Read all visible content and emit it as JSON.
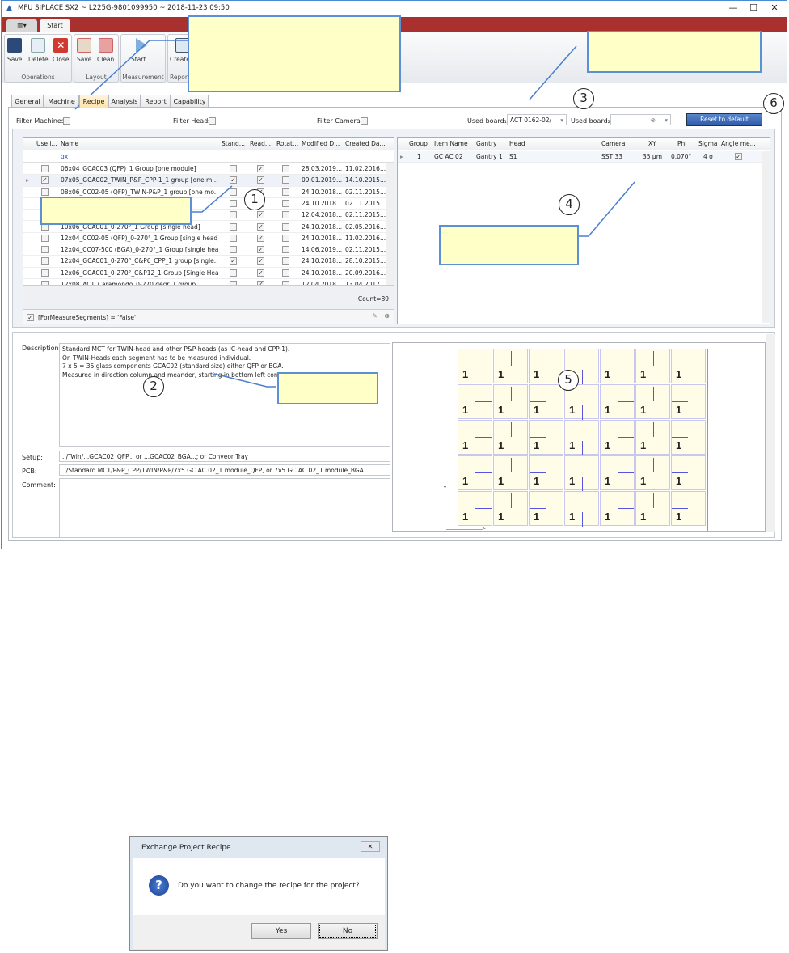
{
  "window": {
    "title": "MFU SIPLACE SX2 ~ L225G-9801099950 ~ 2018-11-23 09:50",
    "minimize": "—",
    "maximize": "☐",
    "close": "✕"
  },
  "ribbon": {
    "tabs": [
      "▥▾",
      "Start"
    ],
    "groups": [
      {
        "label": "Operations",
        "buttons": [
          "Save",
          "Delete",
          "Close"
        ]
      },
      {
        "label": "Layout",
        "buttons": [
          "Save",
          "Clean"
        ]
      },
      {
        "label": "Measurement",
        "buttons": [
          "Start..."
        ]
      },
      {
        "label": "Report",
        "buttons": [
          "Create..."
        ]
      }
    ]
  },
  "tabs": [
    "General",
    "Machine",
    "Recipe",
    "Analysis",
    "Report",
    "Capability"
  ],
  "active_tab": "Recipe",
  "filters": {
    "machines": "Filter Machines",
    "heads": "Filter Heads",
    "cameras": "Filter Cameras"
  },
  "boards": {
    "label1": "Used board₁:",
    "value1": "ACT 0162-02/",
    "label2": "Used board₂:",
    "value2": "",
    "reset": "Reset to default"
  },
  "recipe_grid": {
    "columns": [
      "Use i...",
      "Name",
      "Stand...",
      "Read...",
      "Rotat...",
      "Modified D...",
      "Created Da..."
    ],
    "filter_text": "ɑx",
    "rows": [
      {
        "use": false,
        "name": "06x04_GCAC03 (QFP)_1 Group [one module]",
        "std": false,
        "read": true,
        "rot": false,
        "mod": "28.03.2019...",
        "cre": "11.02.2016..."
      },
      {
        "use": true,
        "name": "07x05_GCAC02_TWIN_P&P_CPP-1_1 group [one m...",
        "std": true,
        "read": true,
        "rot": false,
        "mod": "09.01.2019...",
        "cre": "14.10.2015..."
      },
      {
        "use": false,
        "name": "08x06_CC02-05 (QFP)_TWIN-P&P_1 group [one mo...",
        "std": false,
        "read": true,
        "rot": false,
        "mod": "24.10.2018...",
        "cre": "02.11.2015..."
      },
      {
        "use": false,
        "name": "1 gro...",
        "std": false,
        "read": true,
        "rot": false,
        "mod": "24.10.2018...",
        "cre": "02.11.2015..."
      },
      {
        "use": false,
        "name": "e mo...",
        "std": false,
        "read": true,
        "rot": false,
        "mod": "12.04.2018...",
        "cre": "02.11.2015..."
      },
      {
        "use": false,
        "name": "10x06_GCAC01_0-270°_1 Group [single head]",
        "std": false,
        "read": true,
        "rot": false,
        "mod": "24.10.2018...",
        "cre": "02.05.2016..."
      },
      {
        "use": false,
        "name": "12x04_CC02-05 (QFP)_0-270°_1 Group [single head]",
        "std": false,
        "read": true,
        "rot": false,
        "mod": "24.10.2018...",
        "cre": "11.02.2016..."
      },
      {
        "use": false,
        "name": "12x04_CC07-500 (BGA)_0-270°_1 Group [single head]",
        "std": false,
        "read": true,
        "rot": false,
        "mod": "14.06.2019...",
        "cre": "02.11.2015..."
      },
      {
        "use": false,
        "name": "12x04_GCAC01_0-270°_C&P6_CPP_1 group [single...",
        "std": true,
        "read": true,
        "rot": false,
        "mod": "24.10.2018...",
        "cre": "28.10.2015..."
      },
      {
        "use": false,
        "name": "12x06_GCAC01_0-270°_C&P12_1 Group [Single Hea...",
        "std": false,
        "read": true,
        "rot": false,
        "mod": "24.10.2018...",
        "cre": "20.09.2016..."
      },
      {
        "use": false,
        "name": "12x08_ACT_Caramondo_0-270 degr_1 group",
        "std": false,
        "read": true,
        "rot": false,
        "mod": "12.04.2018...",
        "cre": "13.04.2017..."
      }
    ],
    "count": "Count=89",
    "filter_expr": "[ForMeasureSegments] = 'False'"
  },
  "item_grid": {
    "columns": [
      "Group",
      "Item Name",
      "Gantry",
      "Head",
      "Camera",
      "XY",
      "Phi",
      "Sigma",
      "Angle me..."
    ],
    "rows": [
      {
        "group": "1",
        "item": "GC AC 02",
        "gantry": "Gantry 1",
        "head": "S1",
        "camera": "SST 33",
        "xy": "35 µm",
        "phi": "0.070°",
        "sigma": "4 σ",
        "angle": true
      }
    ]
  },
  "details": {
    "description_label": "Description:",
    "description": [
      "Standard MCT for TWIN-head and other P&P-heads (as IC-head and CPP-1).",
      "On TWIN-Heads each segment has to be measured individual.",
      "7 x 5 = 35 glass components GCAC02 (standard size) either QFP or BGA.",
      "Measured in direction column and meander, starting in bottom left corner."
    ],
    "setup_label": "Setup:",
    "setup": "../Twin/...GCAC02_QFP... or ...GCAC02_BGA...; or Conveor Tray",
    "pcb_label": "PCB:",
    "pcb": "../Standard MCT/P&P_CPP/TWIN/P&P/7x5 GC AC 02_1 module_QFP, or 7x5 GC AC 02_1 module_BGA",
    "comment_label": "Comment:",
    "comment": ""
  },
  "preview": {
    "columns": 7,
    "rows": 5,
    "tile_label": "1",
    "axis_y": "Y",
    "axis_x": "c"
  },
  "callouts": [
    "1",
    "2",
    "3",
    "4",
    "5",
    "6"
  ],
  "dialog": {
    "title": "Exchange Project Recipe",
    "message": "Do you want to change the recipe for the project?",
    "yes": "Yes",
    "no": "No",
    "close": "✕",
    "icon": "question-icon"
  },
  "colors": {
    "ribbon_red": "#a8302f",
    "callout_fill": "#ffffc8",
    "callout_border": "#5b8fd6",
    "reset_button": "#3b67b5"
  }
}
